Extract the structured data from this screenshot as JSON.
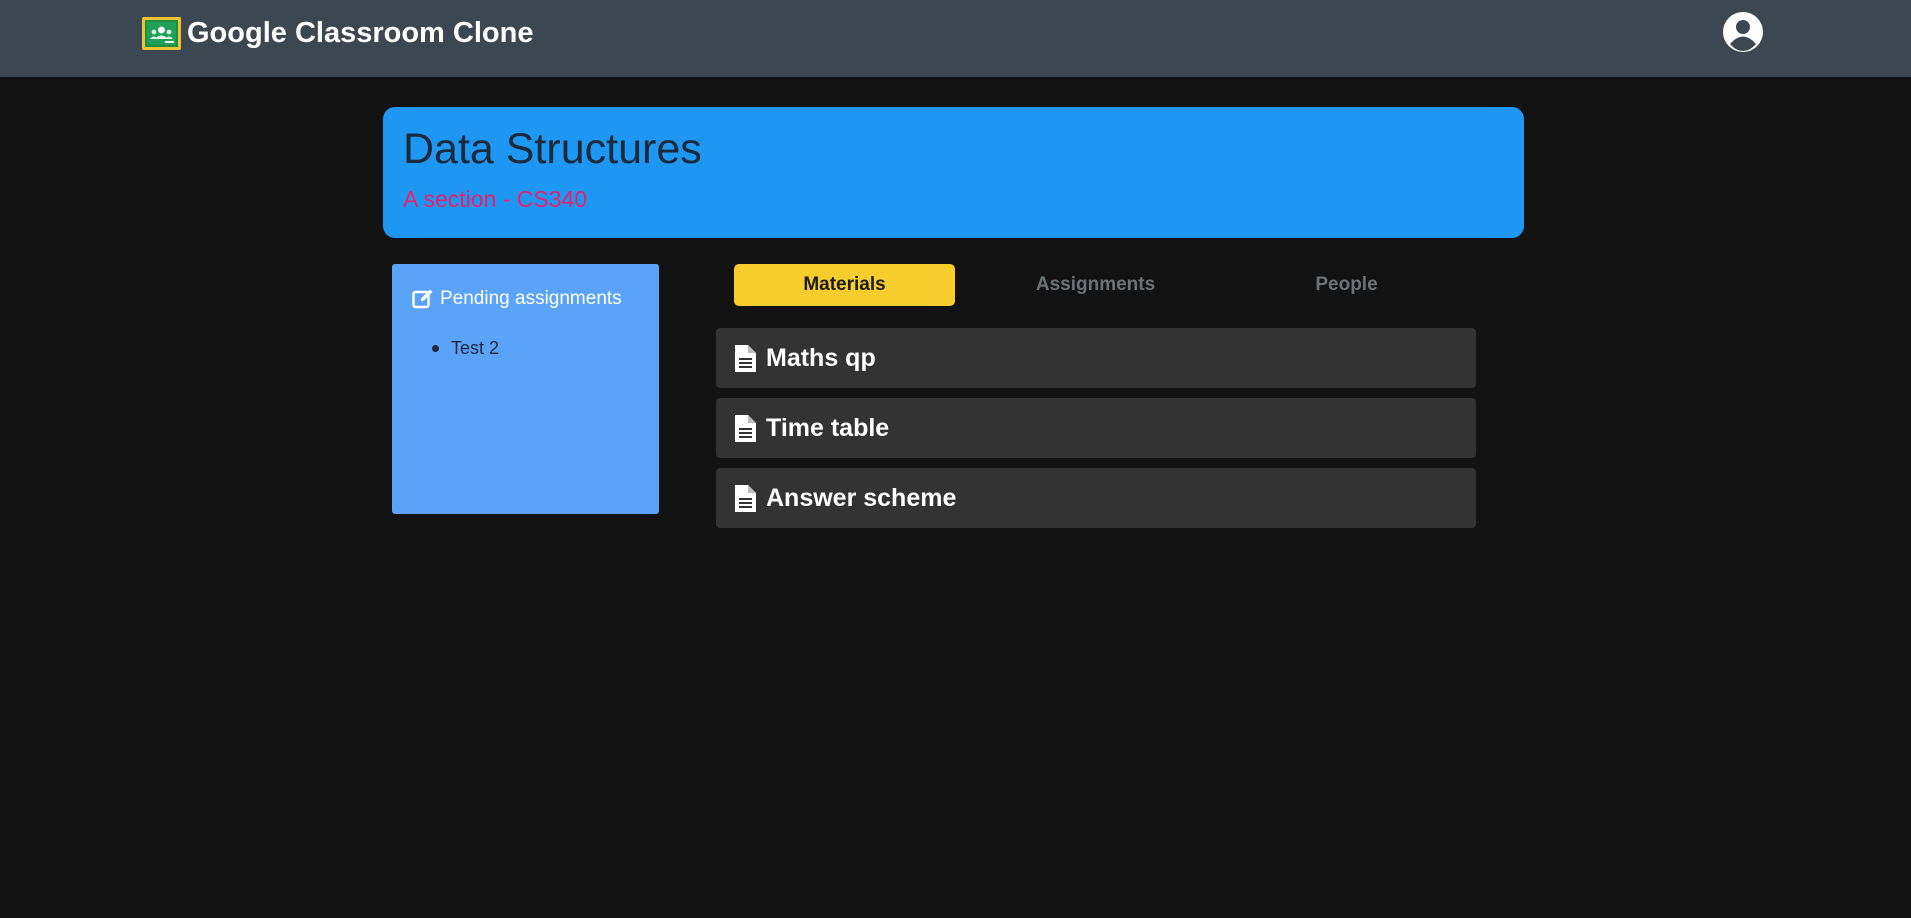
{
  "header": {
    "brand_title": "Google Classroom Clone",
    "logo_icon": "google-classroom-logo",
    "account_icon": "user-circle-icon"
  },
  "class": {
    "title": "Data Structures",
    "subtitle": "A section - CS340"
  },
  "pending": {
    "heading": "Pending assignments",
    "icon": "edit-icon",
    "items": [
      {
        "label": "Test 2"
      }
    ]
  },
  "tabs": [
    {
      "label": "Materials",
      "active": true
    },
    {
      "label": "Assignments",
      "active": false
    },
    {
      "label": "People",
      "active": false
    }
  ],
  "materials": [
    {
      "title": "Maths qp",
      "icon": "file-document-icon"
    },
    {
      "title": "Time table",
      "icon": "file-document-icon"
    },
    {
      "title": "Answer scheme",
      "icon": "file-document-icon"
    }
  ],
  "colors": {
    "topbar": "#3b4852",
    "background": "#121212",
    "banner": "#1e97f3",
    "subtitle": "#e8216a",
    "pending_card": "#5aa3f8",
    "active_tab": "#f7cd2e",
    "material_row": "#333333"
  }
}
